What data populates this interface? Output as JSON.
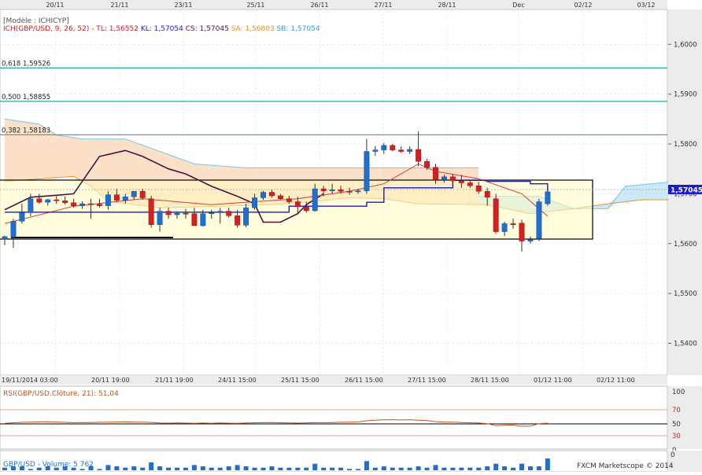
{
  "top_dates": [
    "20/11",
    "21/11",
    "23/11",
    "25/11",
    "26/11",
    "27/11",
    "28/11",
    "Dec",
    "02/12",
    "03/12"
  ],
  "model_label": "[Modèle : ICHICYP]",
  "ichimoku_legend": [
    {
      "text": "ICH(GBP/USD, 9, 26, 52) -",
      "color": "#d11a1a"
    },
    {
      "text": "TL: 1,56552",
      "color": "#d11a1a"
    },
    {
      "text": "KL: 1,57054",
      "color": "#1a1ad1"
    },
    {
      "text": "CS: 1,57045",
      "color": "#4a1040"
    },
    {
      "text": "SA: 1,56803",
      "color": "#f09030"
    },
    {
      "text": "SB: 1,57054",
      "color": "#3a9ad9"
    }
  ],
  "fib_levels": [
    {
      "label": "0,618 1,59526",
      "value": 1.59526
    },
    {
      "label": "0,500 1,58855",
      "value": 1.58855
    },
    {
      "label": "0,382 1,58183",
      "value": 1.58183
    }
  ],
  "price_axis": [
    "1,6000",
    "1,5900",
    "1,5800",
    "1,5700",
    "1,5600",
    "1,5500",
    "1,5400"
  ],
  "current_price": "1,57045",
  "bottom_times": [
    "19/11/2014 03:00",
    "20/11 19:00",
    "21/11 19:00",
    "24/11 15:00",
    "25/11 15:00",
    "26/11 15:00",
    "27/11 15:00",
    "28/11 15:00",
    "01/12 11:00",
    "02/12 11:00"
  ],
  "rsi": {
    "label": "RSI(GBP/USD.Clôture, 21): 51,04",
    "levels": [
      "100",
      "70",
      "50",
      "30",
      "0"
    ]
  },
  "volume": {
    "label": "GBP/USD - Volume: 5 762"
  },
  "footer": "FXCM Marketscope © 2014",
  "colors": {
    "up": "#1e6fd0",
    "down": "#d42020",
    "tenkan": "#e03a3a",
    "kijun": "#1a1ad1",
    "chikou": "#4a1040",
    "senkou_a": "#f09030",
    "senkou_b": "#7cc4e8",
    "fib": "#2aa8a8",
    "box": "#fffcc0"
  },
  "chart_data": {
    "type": "candlestick",
    "symbol": "GBP/USD",
    "ylim": [
      1.5336,
      1.607
    ],
    "candles": [
      {
        "o": 1.5609,
        "h": 1.5616,
        "l": 1.5597,
        "c": 1.5614
      },
      {
        "o": 1.5613,
        "h": 1.565,
        "l": 1.5591,
        "c": 1.5645
      },
      {
        "o": 1.5645,
        "h": 1.568,
        "l": 1.564,
        "c": 1.5662
      },
      {
        "o": 1.5662,
        "h": 1.57,
        "l": 1.5655,
        "c": 1.569
      },
      {
        "o": 1.569,
        "h": 1.57,
        "l": 1.568,
        "c": 1.5683
      },
      {
        "o": 1.5683,
        "h": 1.569,
        "l": 1.5676,
        "c": 1.5688
      },
      {
        "o": 1.5688,
        "h": 1.5695,
        "l": 1.568,
        "c": 1.5686
      },
      {
        "o": 1.5686,
        "h": 1.5695,
        "l": 1.5678,
        "c": 1.5682
      },
      {
        "o": 1.5682,
        "h": 1.569,
        "l": 1.5672,
        "c": 1.5676
      },
      {
        "o": 1.5676,
        "h": 1.5685,
        "l": 1.567,
        "c": 1.568
      },
      {
        "o": 1.568,
        "h": 1.569,
        "l": 1.565,
        "c": 1.5679
      },
      {
        "o": 1.5679,
        "h": 1.569,
        "l": 1.5672,
        "c": 1.5676
      },
      {
        "o": 1.5676,
        "h": 1.5705,
        "l": 1.5668,
        "c": 1.5698
      },
      {
        "o": 1.5698,
        "h": 1.571,
        "l": 1.5683,
        "c": 1.5687
      },
      {
        "o": 1.5687,
        "h": 1.57,
        "l": 1.568,
        "c": 1.5694
      },
      {
        "o": 1.5694,
        "h": 1.5705,
        "l": 1.5688,
        "c": 1.5705
      },
      {
        "o": 1.5705,
        "h": 1.571,
        "l": 1.5688,
        "c": 1.5692
      },
      {
        "o": 1.569,
        "h": 1.5696,
        "l": 1.5632,
        "c": 1.5638
      },
      {
        "o": 1.5638,
        "h": 1.5672,
        "l": 1.5624,
        "c": 1.5665
      },
      {
        "o": 1.5665,
        "h": 1.5672,
        "l": 1.565,
        "c": 1.5658
      },
      {
        "o": 1.5658,
        "h": 1.5665,
        "l": 1.565,
        "c": 1.5661
      },
      {
        "o": 1.5661,
        "h": 1.567,
        "l": 1.565,
        "c": 1.566
      },
      {
        "o": 1.566,
        "h": 1.5672,
        "l": 1.5648,
        "c": 1.5636
      },
      {
        "o": 1.5636,
        "h": 1.5668,
        "l": 1.5634,
        "c": 1.566
      },
      {
        "o": 1.566,
        "h": 1.5668,
        "l": 1.565,
        "c": 1.5662
      },
      {
        "o": 1.5662,
        "h": 1.5672,
        "l": 1.564,
        "c": 1.5665
      },
      {
        "o": 1.5665,
        "h": 1.5672,
        "l": 1.5652,
        "c": 1.5656
      },
      {
        "o": 1.5656,
        "h": 1.5668,
        "l": 1.5632,
        "c": 1.5637
      },
      {
        "o": 1.5637,
        "h": 1.568,
        "l": 1.5633,
        "c": 1.5672
      },
      {
        "o": 1.5672,
        "h": 1.57,
        "l": 1.5668,
        "c": 1.5692
      },
      {
        "o": 1.5692,
        "h": 1.5706,
        "l": 1.5688,
        "c": 1.5703
      },
      {
        "o": 1.5703,
        "h": 1.5708,
        "l": 1.5692,
        "c": 1.5696
      },
      {
        "o": 1.5696,
        "h": 1.57,
        "l": 1.5688,
        "c": 1.569
      },
      {
        "o": 1.569,
        "h": 1.5696,
        "l": 1.568,
        "c": 1.5684
      },
      {
        "o": 1.5684,
        "h": 1.5694,
        "l": 1.5662,
        "c": 1.5674
      },
      {
        "o": 1.5674,
        "h": 1.5684,
        "l": 1.5662,
        "c": 1.5666
      },
      {
        "o": 1.5666,
        "h": 1.572,
        "l": 1.5664,
        "c": 1.571
      },
      {
        "o": 1.571,
        "h": 1.5716,
        "l": 1.5695,
        "c": 1.5706
      },
      {
        "o": 1.5706,
        "h": 1.572,
        "l": 1.57,
        "c": 1.5708
      },
      {
        "o": 1.5708,
        "h": 1.5716,
        "l": 1.57,
        "c": 1.5705
      },
      {
        "o": 1.5705,
        "h": 1.5712,
        "l": 1.5698,
        "c": 1.5704
      },
      {
        "o": 1.5704,
        "h": 1.571,
        "l": 1.57,
        "c": 1.5706
      },
      {
        "o": 1.5706,
        "h": 1.581,
        "l": 1.57,
        "c": 1.5785
      },
      {
        "o": 1.5785,
        "h": 1.5796,
        "l": 1.5776,
        "c": 1.5788
      },
      {
        "o": 1.5788,
        "h": 1.5802,
        "l": 1.578,
        "c": 1.5797
      },
      {
        "o": 1.5797,
        "h": 1.58,
        "l": 1.5785,
        "c": 1.5788
      },
      {
        "o": 1.5788,
        "h": 1.5795,
        "l": 1.5782,
        "c": 1.5785
      },
      {
        "o": 1.5785,
        "h": 1.5795,
        "l": 1.578,
        "c": 1.5789
      },
      {
        "o": 1.5789,
        "h": 1.5825,
        "l": 1.5755,
        "c": 1.5765
      },
      {
        "o": 1.5765,
        "h": 1.577,
        "l": 1.5748,
        "c": 1.5753
      },
      {
        "o": 1.5753,
        "h": 1.576,
        "l": 1.572,
        "c": 1.5728
      },
      {
        "o": 1.5728,
        "h": 1.5738,
        "l": 1.5722,
        "c": 1.5734
      },
      {
        "o": 1.5734,
        "h": 1.574,
        "l": 1.5718,
        "c": 1.5726
      },
      {
        "o": 1.5726,
        "h": 1.5738,
        "l": 1.5712,
        "c": 1.5722
      },
      {
        "o": 1.5722,
        "h": 1.5728,
        "l": 1.5712,
        "c": 1.5716
      },
      {
        "o": 1.5716,
        "h": 1.5724,
        "l": 1.57,
        "c": 1.5705
      },
      {
        "o": 1.5705,
        "h": 1.5712,
        "l": 1.5676,
        "c": 1.5693
      },
      {
        "o": 1.569,
        "h": 1.57,
        "l": 1.562,
        "c": 1.5624
      },
      {
        "o": 1.5624,
        "h": 1.5644,
        "l": 1.5615,
        "c": 1.564
      },
      {
        "o": 1.564,
        "h": 1.565,
        "l": 1.563,
        "c": 1.5638
      },
      {
        "o": 1.5641,
        "h": 1.5648,
        "l": 1.5584,
        "c": 1.5605
      },
      {
        "o": 1.5605,
        "h": 1.5614,
        "l": 1.56,
        "c": 1.5608
      },
      {
        "o": 1.561,
        "h": 1.569,
        "l": 1.5605,
        "c": 1.5684
      },
      {
        "o": 1.568,
        "h": 1.5708,
        "l": 1.5676,
        "c": 1.5704
      }
    ],
    "tenkan": [
      [
        0,
        1.564
      ],
      [
        8,
        1.5675
      ],
      [
        16,
        1.569
      ],
      [
        24,
        1.5678
      ],
      [
        34,
        1.569
      ],
      [
        40,
        1.5705
      ],
      [
        44,
        1.572
      ],
      [
        48,
        1.576
      ],
      [
        50,
        1.5745
      ],
      [
        55,
        1.573
      ],
      [
        60,
        1.57
      ],
      [
        63,
        1.5655
      ]
    ],
    "kijun": [
      [
        0,
        1.5663
      ],
      [
        28,
        1.5663
      ],
      [
        33,
        1.5675
      ],
      [
        42,
        1.5683
      ],
      [
        44,
        1.5712
      ],
      [
        48,
        1.5712
      ],
      [
        52,
        1.5727
      ],
      [
        56,
        1.5725
      ],
      [
        61,
        1.572
      ],
      [
        63,
        1.5705
      ]
    ],
    "chikou": [
      [
        0,
        1.5668
      ],
      [
        3,
        1.5693
      ],
      [
        6,
        1.5697
      ],
      [
        8,
        1.57
      ],
      [
        11,
        1.5775
      ],
      [
        14,
        1.5787
      ],
      [
        16,
        1.5775
      ],
      [
        19,
        1.575
      ],
      [
        21,
        1.574
      ],
      [
        24,
        1.5715
      ],
      [
        27,
        1.5695
      ],
      [
        29,
        1.568
      ],
      [
        30,
        1.5643
      ],
      [
        32,
        1.5643
      ],
      [
        34,
        1.566
      ],
      [
        35,
        1.5678
      ],
      [
        37,
        1.57
      ]
    ],
    "senkou_a": [
      [
        0,
        1.5725
      ],
      [
        8,
        1.5735
      ],
      [
        10,
        1.5715
      ],
      [
        12,
        1.5685
      ],
      [
        18,
        1.5672
      ],
      [
        25,
        1.5675
      ],
      [
        31,
        1.5678
      ],
      [
        36,
        1.5685
      ],
      [
        40,
        1.5692
      ],
      [
        44,
        1.569
      ],
      [
        48,
        1.568
      ],
      [
        56,
        1.5678
      ],
      [
        61,
        1.566
      ],
      [
        66,
        1.567
      ],
      [
        70,
        1.568
      ],
      [
        74,
        1.5688
      ],
      [
        78,
        1.5688
      ]
    ],
    "senkou_b": [
      [
        0,
        1.579
      ],
      [
        4,
        1.578
      ],
      [
        8,
        1.576
      ],
      [
        10,
        1.5735
      ],
      [
        11,
        1.5728
      ],
      [
        18,
        1.5725
      ],
      [
        28,
        1.5725
      ],
      [
        38,
        1.5725
      ],
      [
        48,
        1.5725
      ],
      [
        54,
        1.5725
      ],
      [
        55,
        1.5695
      ],
      [
        62,
        1.5695
      ],
      [
        66,
        1.567
      ],
      [
        70,
        1.567
      ],
      [
        72,
        1.5715
      ],
      [
        78,
        1.5725
      ]
    ],
    "senkou_b_upper": [
      [
        0,
        1.585
      ],
      [
        4,
        1.584
      ],
      [
        6,
        1.5818
      ],
      [
        9,
        1.581
      ],
      [
        14,
        1.581
      ],
      [
        18,
        1.5785
      ],
      [
        22,
        1.576
      ],
      [
        28,
        1.5752
      ],
      [
        36,
        1.5752
      ],
      [
        44,
        1.5752
      ],
      [
        50,
        1.5752
      ],
      [
        52,
        1.5752
      ],
      [
        55,
        1.5752
      ]
    ],
    "rsi": [
      50.8,
      51.5,
      52.2,
      52.5,
      52.8,
      53.0,
      52.6,
      52.2,
      51.8,
      52.0,
      51.9,
      52.3,
      52.6,
      52.7,
      52.9,
      52.5,
      52.4,
      52.1,
      51.2,
      51.0,
      51.3,
      51.1,
      50.9,
      51.2,
      50.8,
      51.3,
      51.0,
      50.9,
      51.2,
      51.5,
      51.8,
      52.0,
      51.5,
      51.3,
      51.1,
      51.4,
      51.8,
      51.8,
      52.0,
      52.3,
      52.5,
      52.8,
      54.5,
      55.2,
      55.8,
      56.0,
      55.6,
      55.8,
      55.2,
      54.7,
      53.2,
      52.6,
      52.5,
      52.0,
      51.5,
      51.2,
      50.3,
      47.5,
      48.0,
      48.3,
      46.5,
      47.0,
      50.3,
      51.0
    ],
    "volume": [
      2,
      3,
      3,
      1,
      2,
      3,
      2,
      3,
      2,
      1,
      3,
      1,
      4,
      3,
      2,
      3,
      2,
      6,
      3,
      2,
      2,
      2,
      4,
      3,
      2,
      2,
      3,
      4,
      3,
      2,
      2,
      3,
      2,
      2,
      2,
      2,
      5,
      2,
      2,
      2,
      1,
      1,
      7,
      2,
      3,
      2,
      2,
      2,
      3,
      2,
      4,
      2,
      2,
      2,
      2,
      2,
      3,
      5,
      3,
      2,
      5,
      3,
      3,
      9
    ]
  }
}
